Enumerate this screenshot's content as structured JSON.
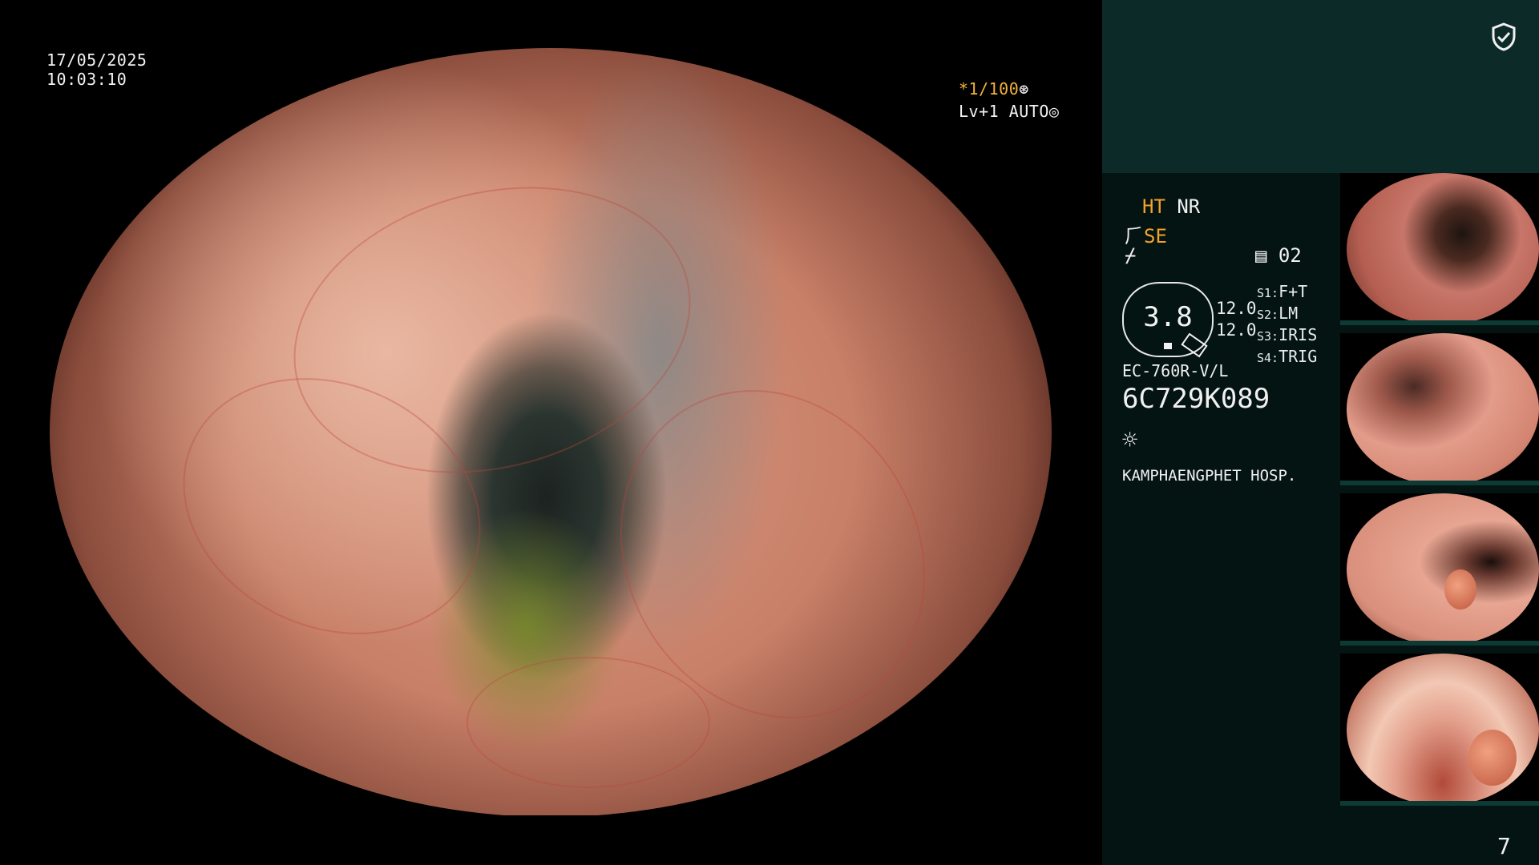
{
  "overlay": {
    "date": "17/05/2025",
    "time": "10:03:10",
    "shutter": "*1/100",
    "shutter_icon": "aperture-icon",
    "level": "Lv+1 AUTO",
    "level_icon": "iris-icon"
  },
  "panel": {
    "shield_icon": "shield-check-icon",
    "ht": "HT",
    "nr": "NR",
    "se": "SE",
    "capture_icon": "film-icon",
    "capture_count": "02",
    "gauge_value": "3.8",
    "val1": "12.0",
    "val2": "12.0",
    "s1_key": "S1:",
    "s1_val": "F+T",
    "s2_key": "S2:",
    "s2_val": "LM",
    "s3_key": "S3:",
    "s3_val": "IRIS",
    "s4_key": "S4:",
    "s4_val": "TRIG",
    "model": "EC-760R-V/L",
    "serial": "6C729K089",
    "light_icon": "sun-icon",
    "hospital": "KAMPHAENGPHET HOSP.",
    "page_number": "7"
  },
  "colors": {
    "accent": "#f2a22a",
    "panel_top": "#0c2a28",
    "panel_main": "#041412"
  }
}
